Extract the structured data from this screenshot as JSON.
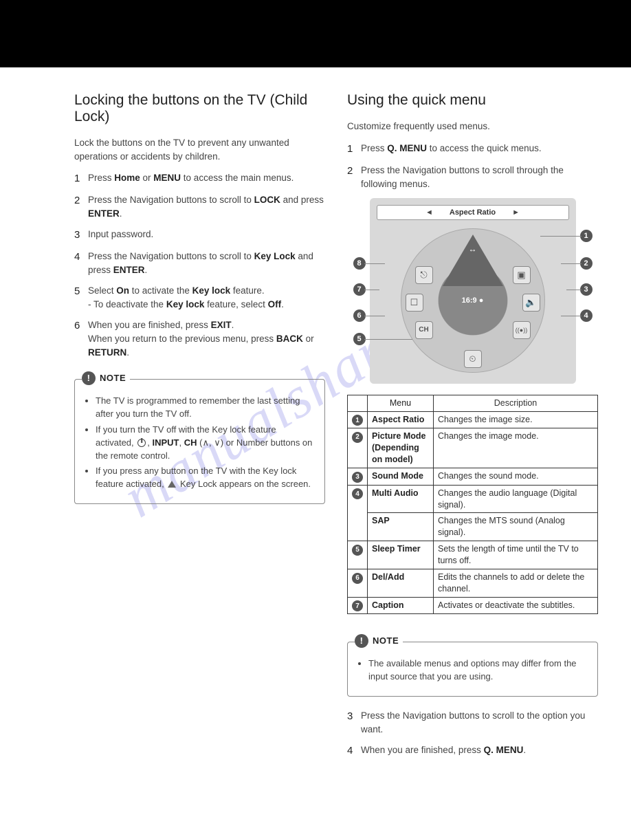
{
  "watermark": "manualshare.com",
  "left": {
    "heading": "Locking the buttons on the TV (Child Lock)",
    "intro": "Lock the buttons on the TV to prevent any unwanted operations or accidents by children.",
    "steps": [
      {
        "pre": "Press ",
        "b1": "Home",
        "mid": " or ",
        "b2": "MENU",
        "post": " to access the main menus."
      },
      {
        "pre": "Press the Navigation buttons to scroll to ",
        "b1": "LOCK",
        "mid": " and press ",
        "b2": "ENTER",
        "post": "."
      },
      {
        "pre": "Input password.",
        "b1": "",
        "mid": "",
        "b2": "",
        "post": ""
      },
      {
        "pre": "Press the Navigation buttons to scroll to ",
        "b1": "Key Lock",
        "mid": " and press ",
        "b2": "ENTER",
        "post": "."
      },
      {
        "pre": "Select ",
        "b1": "On",
        "mid": " to activate the ",
        "b2": "Key lock",
        "post": " feature.",
        "sub_pre": "- To deactivate the ",
        "sub_b1": "Key lock",
        "sub_mid": " feature, select ",
        "sub_b2": "Off",
        "sub_post": "."
      },
      {
        "pre": "When you are finished, press ",
        "b1": "EXIT",
        "mid": ".",
        "b2": "",
        "post": "",
        "sub_pre": "When you return to the previous menu, press ",
        "sub_b1": "BACK",
        "sub_mid": " or ",
        "sub_b2": "RETURN",
        "sub_post": "."
      }
    ],
    "note": {
      "title": "NOTE",
      "items": [
        "The TV is programmed to remember the last setting after you turn the TV off.",
        {
          "pre": "If you turn the TV off with the Key lock feature activated, ",
          "icons": true,
          "mid": ", ",
          "b1": "INPUT",
          "mid2": ", ",
          "b2": "CH",
          "paren": " (∧, ∨) or Number buttons on the remote control."
        },
        {
          "pre": "If you press any button on the TV with the Key lock feature activated, ",
          "tri": true,
          "post": " Key Lock appears on the screen."
        }
      ]
    }
  },
  "right": {
    "heading": "Using the quick menu",
    "intro": "Customize frequently used menus.",
    "steps_top": [
      {
        "pre": "Press ",
        "b1": "Q. MENU",
        "post": " to access the quick menus."
      },
      {
        "pre": "Press the Navigation buttons to scroll through the following menus."
      }
    ],
    "diagram": {
      "bar_label": "Aspect Ratio",
      "center_label": "16:9 ●",
      "left_arrow": "◄",
      "right_arrow": "►",
      "side_nums": [
        "1",
        "2",
        "3",
        "4",
        "5",
        "6",
        "7",
        "8"
      ],
      "icon_names": {
        "1": "aspect-ratio-icon",
        "2": "picture-mode-icon",
        "3": "sound-mode-icon",
        "4": "multi-audio-icon",
        "5": "sleep-timer-icon",
        "6": "channel-del-add-icon",
        "7": "caption-icon",
        "8": "usb-eject-icon"
      },
      "icon_glyphs": {
        "1": "↔",
        "2": "▣",
        "3": "🔈",
        "4": "((●))",
        "5": "⏲",
        "6": "CH",
        "7": "☐",
        "8": "⎋"
      }
    },
    "table": {
      "head_menu": "Menu",
      "head_desc": "Description",
      "rows": [
        {
          "n": "1",
          "menu": "Aspect Ratio",
          "desc": "Changes the image size."
        },
        {
          "n": "2",
          "menu": "Picture Mode (Depending on model)",
          "desc": "Changes the image mode."
        },
        {
          "n": "3",
          "menu": "Sound Mode",
          "desc": "Changes the sound mode."
        },
        {
          "n": "4",
          "menu": "Multi Audio",
          "desc": "Changes the audio language (Digital signal)."
        },
        {
          "n": "",
          "menu": "SAP",
          "desc": "Changes the MTS sound (Analog signal)."
        },
        {
          "n": "5",
          "menu": "Sleep Timer",
          "desc": "Sets the length of time until the TV to turns off."
        },
        {
          "n": "6",
          "menu": "Del/Add",
          "desc": "Edits the channels to add or delete the channel."
        },
        {
          "n": "7",
          "menu": "Caption",
          "desc": "Activates or deactivate the subtitles."
        }
      ]
    },
    "note": {
      "title": "NOTE",
      "text": "The available menus and options may differ from the input source that you are using."
    },
    "steps_bottom": [
      {
        "n": "3",
        "pre": "Press the Navigation buttons to scroll to the option you want."
      },
      {
        "n": "4",
        "pre": "When you are finished, press ",
        "b1": "Q. MENU",
        "post": "."
      }
    ]
  }
}
